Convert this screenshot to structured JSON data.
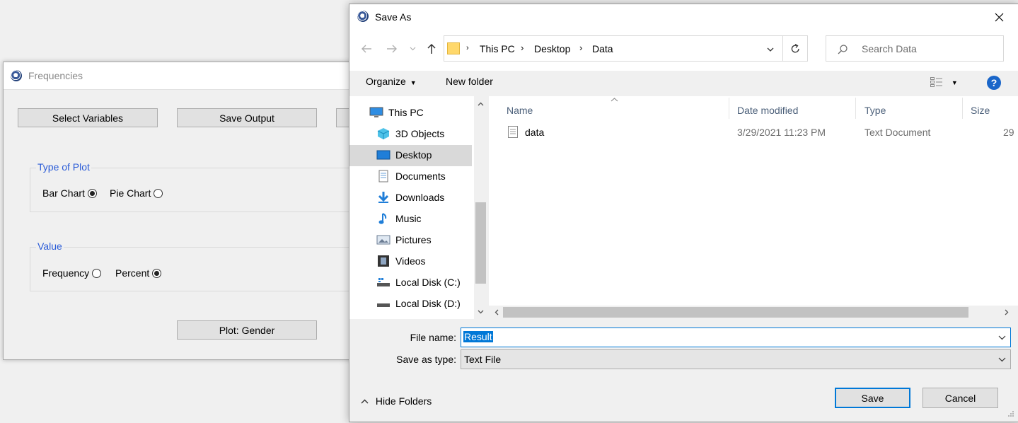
{
  "frequencies": {
    "title": "Frequencies",
    "buttons": {
      "select_variables": "Select Variables",
      "save_output": "Save Output",
      "plot": "Plot: Gender"
    },
    "plot_type_group": {
      "title": "Type of Plot",
      "options": [
        {
          "label": "Bar Chart",
          "checked": true
        },
        {
          "label": "Pie Chart",
          "checked": false
        }
      ]
    },
    "value_group": {
      "title": "Value",
      "options": [
        {
          "label": "Frequency",
          "checked": false
        },
        {
          "label": "Percent",
          "checked": true
        }
      ]
    }
  },
  "save_as": {
    "title": "Save As",
    "address": {
      "crumbs": [
        "This PC",
        "Desktop",
        "Data"
      ]
    },
    "search_placeholder": "Search Data",
    "toolbar": {
      "organize": "Organize",
      "new_folder": "New folder"
    },
    "sidebar": {
      "items": [
        {
          "label": "This PC",
          "icon": "monitor-icon"
        },
        {
          "label": "3D Objects",
          "icon": "cube-icon"
        },
        {
          "label": "Desktop",
          "icon": "desktop-icon",
          "selected": true
        },
        {
          "label": "Documents",
          "icon": "document-icon"
        },
        {
          "label": "Downloads",
          "icon": "download-icon"
        },
        {
          "label": "Music",
          "icon": "music-icon"
        },
        {
          "label": "Pictures",
          "icon": "pictures-icon"
        },
        {
          "label": "Videos",
          "icon": "videos-icon"
        },
        {
          "label": "Local Disk (C:)",
          "icon": "drive-icon"
        },
        {
          "label": "Local Disk (D:)",
          "icon": "drive-icon"
        }
      ]
    },
    "columns": {
      "name": "Name",
      "date": "Date modified",
      "type": "Type",
      "size": "Size"
    },
    "files": [
      {
        "name": "data",
        "date": "3/29/2021 11:23 PM",
        "type": "Text Document",
        "size": "29"
      }
    ],
    "file_name_label": "File name:",
    "file_name_value": "Result",
    "save_type_label": "Save as type:",
    "save_type_value": "Text File",
    "hide_folders": "Hide Folders",
    "save_button": "Save",
    "cancel_button": "Cancel"
  },
  "colors": {
    "accent": "#0078d7",
    "group_title": "#2a5bd7",
    "selection": "#cce8ff"
  }
}
